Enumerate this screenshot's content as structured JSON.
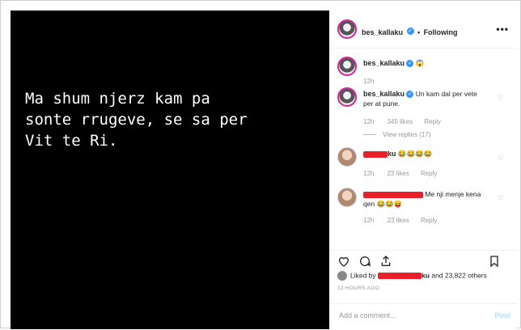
{
  "photo": {
    "caption_lines": "Ma shum njerz kam pa\nsonte rrugeve, se sa per\nVit te Ri."
  },
  "header": {
    "username": "bes_kallaku",
    "separator": "•",
    "follow_label": "Following",
    "more_label": "•••"
  },
  "comments": [
    {
      "username": "bes_kallaku",
      "text": "😱",
      "time": "12h"
    },
    {
      "username": "bes_kallaku",
      "text": "Un kam dal per vete per at pune.",
      "time": "12h",
      "likes": "345 likes",
      "reply": "Reply",
      "view_replies": "View replies (17)"
    },
    {
      "username_suffix": "ku",
      "text": "😂😂😂😂",
      "time": "12h",
      "likes": "23 likes",
      "reply": "Reply"
    },
    {
      "text": "Me nji menje kena qen 😂😂😝",
      "time": "12h",
      "likes": "23 likes",
      "reply": "Reply"
    }
  ],
  "likes": {
    "prefix": "Liked by",
    "suffix": "ku",
    "and_text": "and 23,822 others"
  },
  "time_ago": "12 HOURS AGO",
  "add_comment": {
    "placeholder": "Add a comment...",
    "post_label": "Post"
  },
  "icons": {
    "like": "heart-icon",
    "comment": "comment-icon",
    "share": "share-icon",
    "save": "bookmark-icon"
  },
  "colors": {
    "verified": "#3897f0",
    "redaction": "#e8202a",
    "story_ring": "#d6249f"
  }
}
